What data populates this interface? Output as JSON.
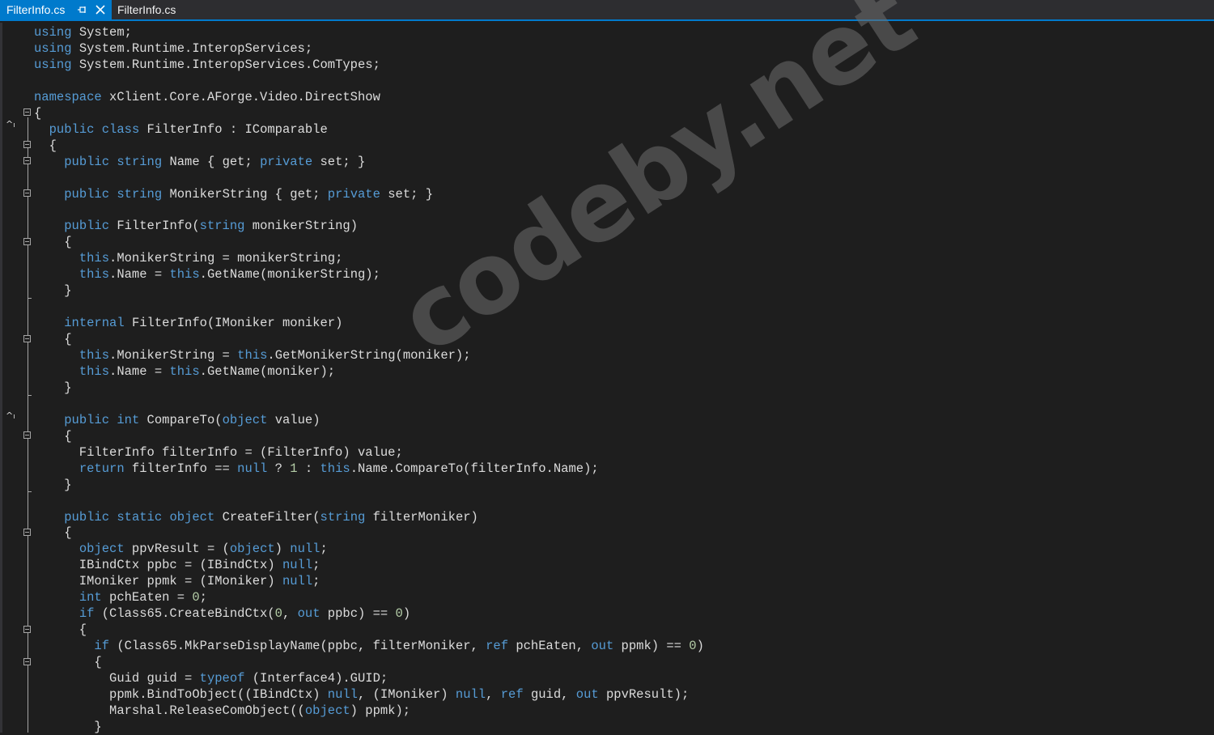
{
  "tabs": {
    "active": {
      "label": "FilterInfo.cs",
      "pin_glyph": "⊸",
      "close_glyph": "✕"
    },
    "preview": {
      "label": "FilterInfo.cs"
    }
  },
  "colors": {
    "keyword": "#569cd6",
    "text": "#dcdcdc",
    "number": "#b5cea8",
    "accent": "#007acc"
  },
  "editor": {
    "lines": [
      [
        [
          "k",
          "using"
        ],
        [
          "t",
          " System;"
        ]
      ],
      [
        [
          "k",
          "using"
        ],
        [
          "t",
          " System.Runtime.InteropServices;"
        ]
      ],
      [
        [
          "k",
          "using"
        ],
        [
          "t",
          " System.Runtime.InteropServices.ComTypes;"
        ]
      ],
      [],
      [
        [
          "k",
          "namespace"
        ],
        [
          "t",
          " xClient.Core.AForge.Video.DirectShow"
        ]
      ],
      [
        [
          "t",
          "{"
        ]
      ],
      [
        [
          "t",
          "  "
        ],
        [
          "k",
          "public"
        ],
        [
          "t",
          " "
        ],
        [
          "k",
          "class"
        ],
        [
          "t",
          " FilterInfo : IComparable"
        ]
      ],
      [
        [
          "t",
          "  {"
        ]
      ],
      [
        [
          "t",
          "    "
        ],
        [
          "k",
          "public"
        ],
        [
          "t",
          " "
        ],
        [
          "k",
          "string"
        ],
        [
          "t",
          " Name { get; "
        ],
        [
          "k",
          "private"
        ],
        [
          "t",
          " set; }"
        ]
      ],
      [],
      [
        [
          "t",
          "    "
        ],
        [
          "k",
          "public"
        ],
        [
          "t",
          " "
        ],
        [
          "k",
          "string"
        ],
        [
          "t",
          " MonikerString { get; "
        ],
        [
          "k",
          "private"
        ],
        [
          "t",
          " set; }"
        ]
      ],
      [],
      [
        [
          "t",
          "    "
        ],
        [
          "k",
          "public"
        ],
        [
          "t",
          " FilterInfo("
        ],
        [
          "k",
          "string"
        ],
        [
          "t",
          " monikerString)"
        ]
      ],
      [
        [
          "t",
          "    {"
        ]
      ],
      [
        [
          "t",
          "      "
        ],
        [
          "k",
          "this"
        ],
        [
          "t",
          ".MonikerString = monikerString;"
        ]
      ],
      [
        [
          "t",
          "      "
        ],
        [
          "k",
          "this"
        ],
        [
          "t",
          ".Name = "
        ],
        [
          "k",
          "this"
        ],
        [
          "t",
          ".GetName(monikerString);"
        ]
      ],
      [
        [
          "t",
          "    }"
        ]
      ],
      [],
      [
        [
          "t",
          "    "
        ],
        [
          "k",
          "internal"
        ],
        [
          "t",
          " FilterInfo(IMoniker moniker)"
        ]
      ],
      [
        [
          "t",
          "    {"
        ]
      ],
      [
        [
          "t",
          "      "
        ],
        [
          "k",
          "this"
        ],
        [
          "t",
          ".MonikerString = "
        ],
        [
          "k",
          "this"
        ],
        [
          "t",
          ".GetMonikerString(moniker);"
        ]
      ],
      [
        [
          "t",
          "      "
        ],
        [
          "k",
          "this"
        ],
        [
          "t",
          ".Name = "
        ],
        [
          "k",
          "this"
        ],
        [
          "t",
          ".GetName(moniker);"
        ]
      ],
      [
        [
          "t",
          "    }"
        ]
      ],
      [],
      [
        [
          "t",
          "    "
        ],
        [
          "k",
          "public"
        ],
        [
          "t",
          " "
        ],
        [
          "k",
          "int"
        ],
        [
          "t",
          " CompareTo("
        ],
        [
          "k",
          "object"
        ],
        [
          "t",
          " value)"
        ]
      ],
      [
        [
          "t",
          "    {"
        ]
      ],
      [
        [
          "t",
          "      FilterInfo filterInfo = (FilterInfo) value;"
        ]
      ],
      [
        [
          "t",
          "      "
        ],
        [
          "k",
          "return"
        ],
        [
          "t",
          " filterInfo == "
        ],
        [
          "k",
          "null"
        ],
        [
          "t",
          " ? "
        ],
        [
          "n",
          "1"
        ],
        [
          "t",
          " : "
        ],
        [
          "k",
          "this"
        ],
        [
          "t",
          ".Name.CompareTo(filterInfo.Name);"
        ]
      ],
      [
        [
          "t",
          "    }"
        ]
      ],
      [],
      [
        [
          "t",
          "    "
        ],
        [
          "k",
          "public"
        ],
        [
          "t",
          " "
        ],
        [
          "k",
          "static"
        ],
        [
          "t",
          " "
        ],
        [
          "k",
          "object"
        ],
        [
          "t",
          " CreateFilter("
        ],
        [
          "k",
          "string"
        ],
        [
          "t",
          " filterMoniker)"
        ]
      ],
      [
        [
          "t",
          "    {"
        ]
      ],
      [
        [
          "t",
          "      "
        ],
        [
          "k",
          "object"
        ],
        [
          "t",
          " ppvResult = ("
        ],
        [
          "k",
          "object"
        ],
        [
          "t",
          ") "
        ],
        [
          "k",
          "null"
        ],
        [
          "t",
          ";"
        ]
      ],
      [
        [
          "t",
          "      IBindCtx ppbc = (IBindCtx) "
        ],
        [
          "k",
          "null"
        ],
        [
          "t",
          ";"
        ]
      ],
      [
        [
          "t",
          "      IMoniker ppmk = (IMoniker) "
        ],
        [
          "k",
          "null"
        ],
        [
          "t",
          ";"
        ]
      ],
      [
        [
          "t",
          "      "
        ],
        [
          "k",
          "int"
        ],
        [
          "t",
          " pchEaten = "
        ],
        [
          "n",
          "0"
        ],
        [
          "t",
          ";"
        ]
      ],
      [
        [
          "t",
          "      "
        ],
        [
          "k",
          "if"
        ],
        [
          "t",
          " (Class65.CreateBindCtx("
        ],
        [
          "n",
          "0"
        ],
        [
          "t",
          ", "
        ],
        [
          "k",
          "out"
        ],
        [
          "t",
          " ppbc) == "
        ],
        [
          "n",
          "0"
        ],
        [
          "t",
          ")"
        ]
      ],
      [
        [
          "t",
          "      {"
        ]
      ],
      [
        [
          "t",
          "        "
        ],
        [
          "k",
          "if"
        ],
        [
          "t",
          " (Class65.MkParseDisplayName(ppbc, filterMoniker, "
        ],
        [
          "k",
          "ref"
        ],
        [
          "t",
          " pchEaten, "
        ],
        [
          "k",
          "out"
        ],
        [
          "t",
          " ppmk) == "
        ],
        [
          "n",
          "0"
        ],
        [
          "t",
          ")"
        ]
      ],
      [
        [
          "t",
          "        {"
        ]
      ],
      [
        [
          "t",
          "          Guid guid = "
        ],
        [
          "k",
          "typeof"
        ],
        [
          "t",
          " (Interface4).GUID;"
        ]
      ],
      [
        [
          "t",
          "          ppmk.BindToObject((IBindCtx) "
        ],
        [
          "k",
          "null"
        ],
        [
          "t",
          ", (IMoniker) "
        ],
        [
          "k",
          "null"
        ],
        [
          "t",
          ", "
        ],
        [
          "k",
          "ref"
        ],
        [
          "t",
          " guid, "
        ],
        [
          "k",
          "out"
        ],
        [
          "t",
          " ppvResult);"
        ]
      ],
      [
        [
          "t",
          "          Marshal.ReleaseComObject(("
        ],
        [
          "k",
          "object"
        ],
        [
          "t",
          ") ppmk);"
        ]
      ],
      [
        [
          "t",
          "        }"
        ]
      ]
    ]
  },
  "watermark": {
    "text": "codeby.net"
  }
}
